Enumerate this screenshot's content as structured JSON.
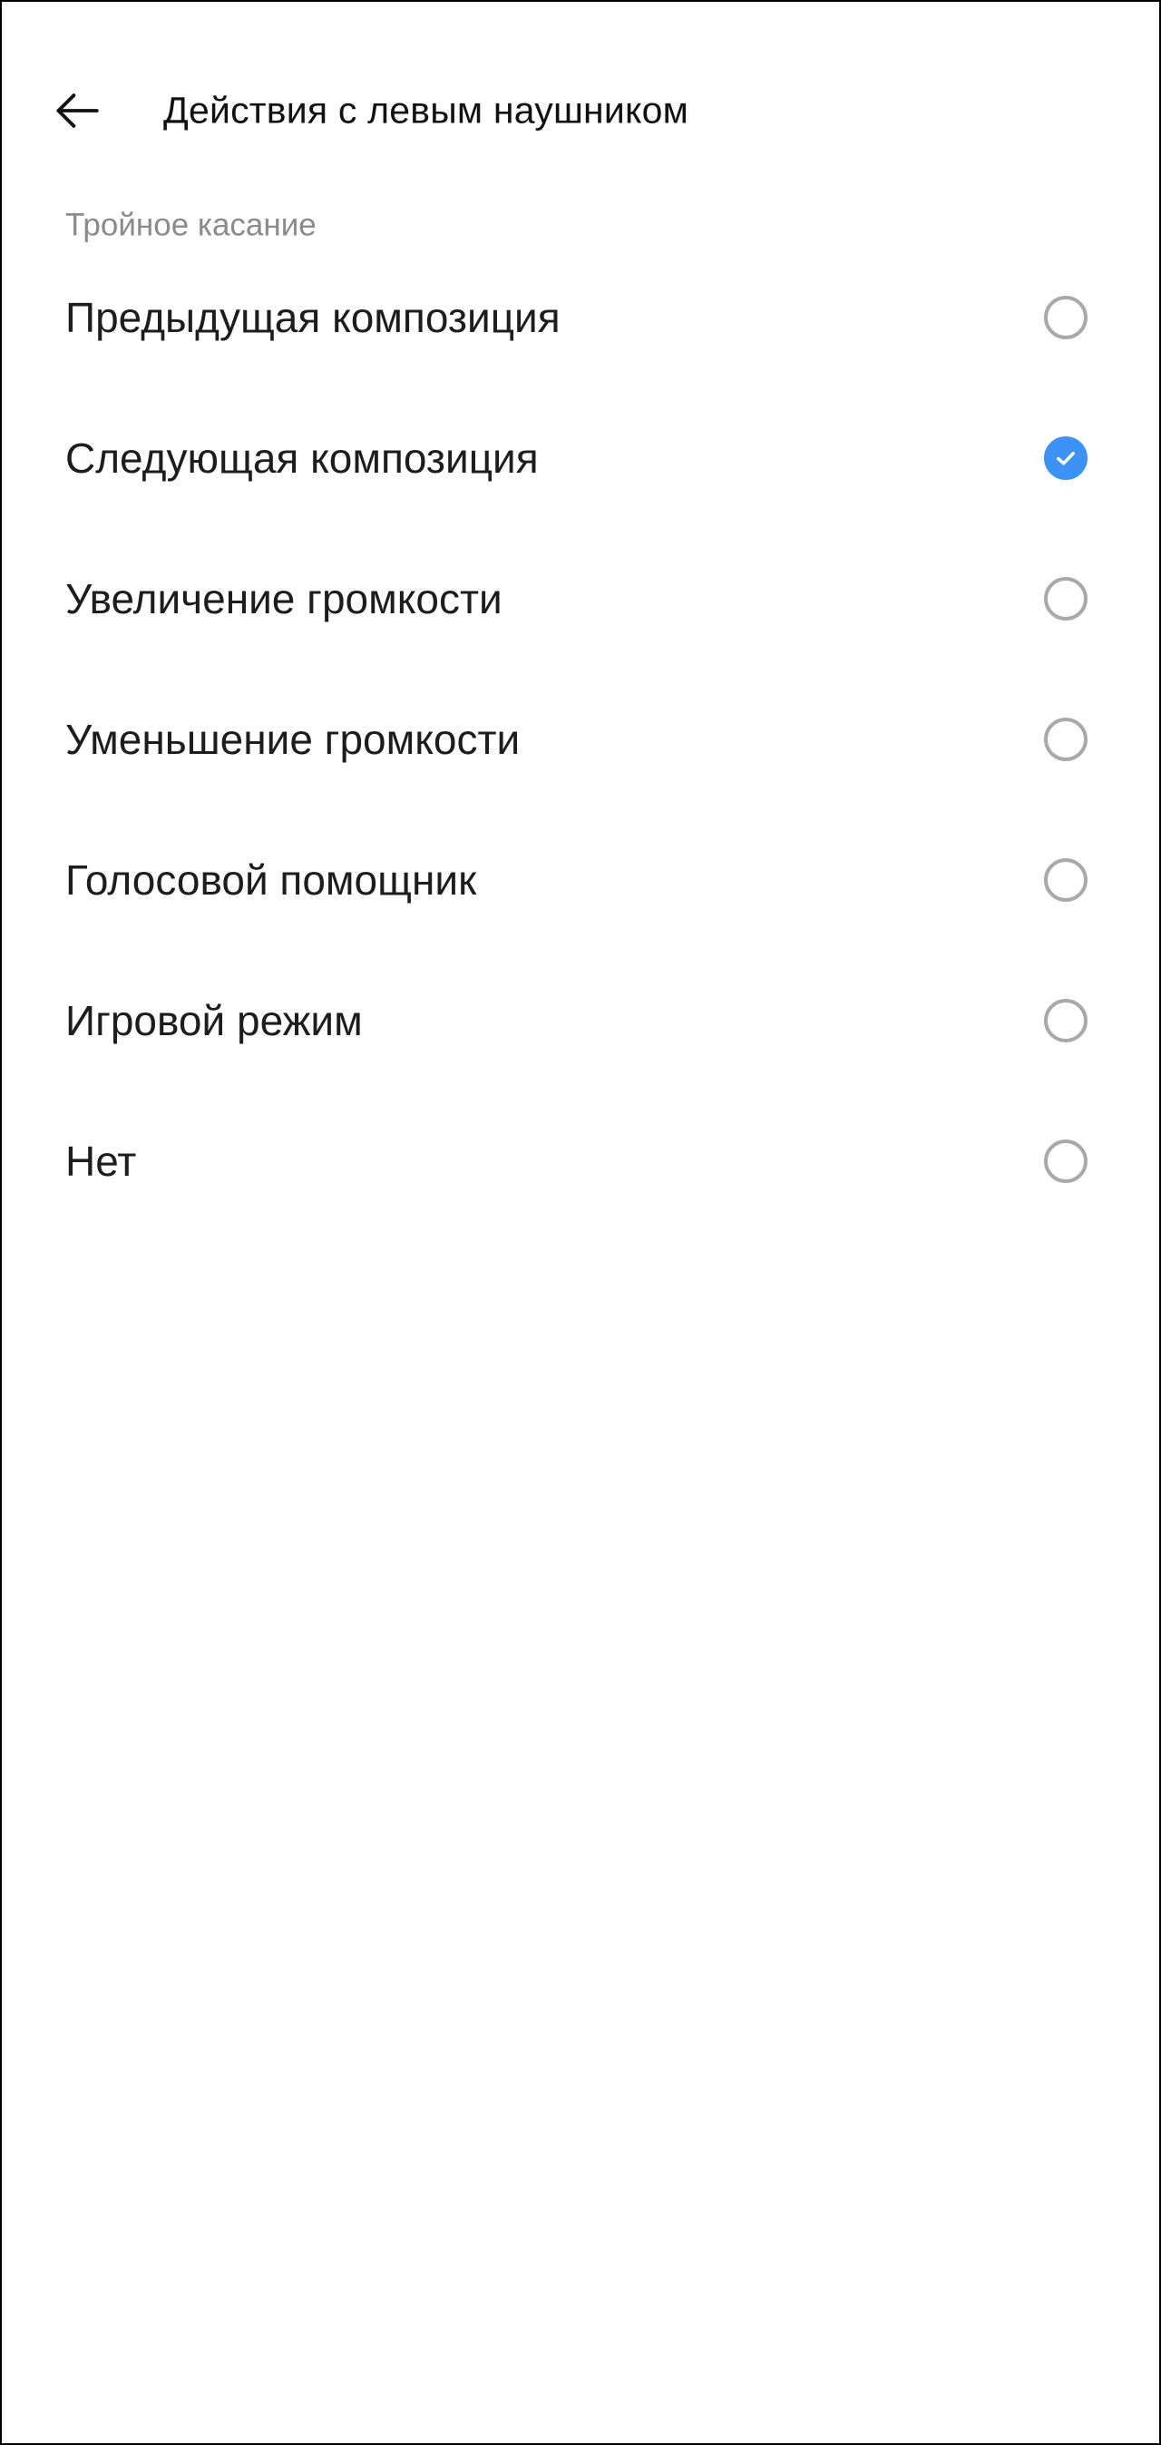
{
  "header": {
    "back_icon": "back-arrow-icon",
    "title": "Действия с левым наушником"
  },
  "section": {
    "title": "Тройное касание"
  },
  "options": [
    {
      "label": "Предыдущая композиция",
      "selected": false
    },
    {
      "label": "Следующая композиция",
      "selected": true
    },
    {
      "label": "Увеличение громкости",
      "selected": false
    },
    {
      "label": "Уменьшение громкости",
      "selected": false
    },
    {
      "label": "Голосовой помощник",
      "selected": false
    },
    {
      "label": "Игровой режим",
      "selected": false
    },
    {
      "label": "Нет",
      "selected": false
    }
  ],
  "colors": {
    "accent": "#3d93f5",
    "radio_unchecked": "#a9a9a9",
    "section_header": "#8b8b8b",
    "text": "#1d1d1d",
    "background": "#ffffff"
  }
}
